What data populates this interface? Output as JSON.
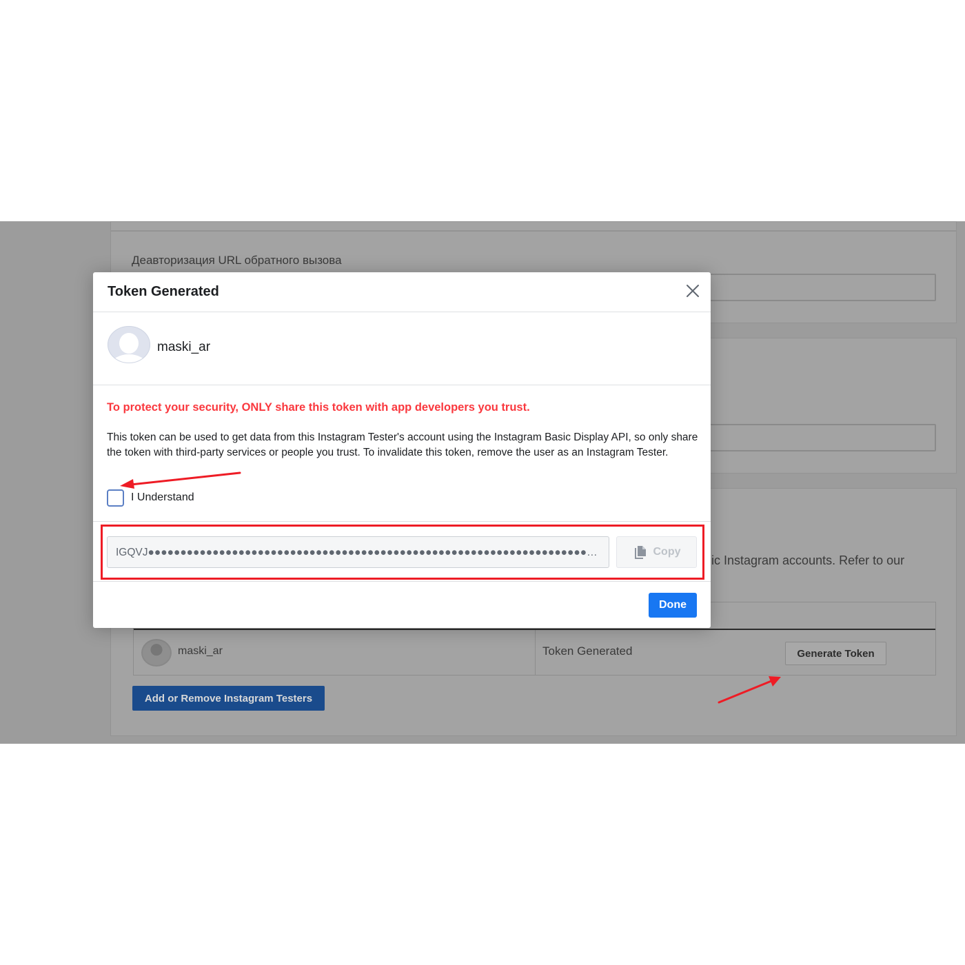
{
  "background": {
    "deauth_label": "Деавторизация URL обратного вызова",
    "partial_text": "blic Instagram accounts. Refer to our",
    "table_row": {
      "username": "maski_ar",
      "status": "Token Generated",
      "generate_button": "Generate Token"
    },
    "add_remove_button": "Add or Remove Instagram Testers"
  },
  "modal": {
    "title": "Token Generated",
    "username": "maski_ar",
    "warning": "To protect your security, ONLY share this token with app developers you trust.",
    "info": "This token can be used to get data from this Instagram Tester's account using the Instagram Basic Display API, so only share the token with third-party services or people you trust. To invalidate this token, remove the user as an Instagram Tester.",
    "understand_label": "I Understand",
    "token_value": "IGQVJ●●●●●●●●●●●●●●●●●●●●●●●●●●●●●●●●●●●●●●●●●●●●●●●●●●●●●●●●●●●●●●●●●●●●●●●●●●●●●●●",
    "copy_label": "Copy",
    "done_label": "Done"
  },
  "colors": {
    "warning": "#fa383e",
    "primary_button": "#1877f2",
    "annotation_red": "#ee1c25",
    "overlay": "#9c9c9c"
  },
  "icons": [
    "close-icon",
    "avatar-placeholder-icon",
    "copy-icon",
    "checkbox"
  ]
}
